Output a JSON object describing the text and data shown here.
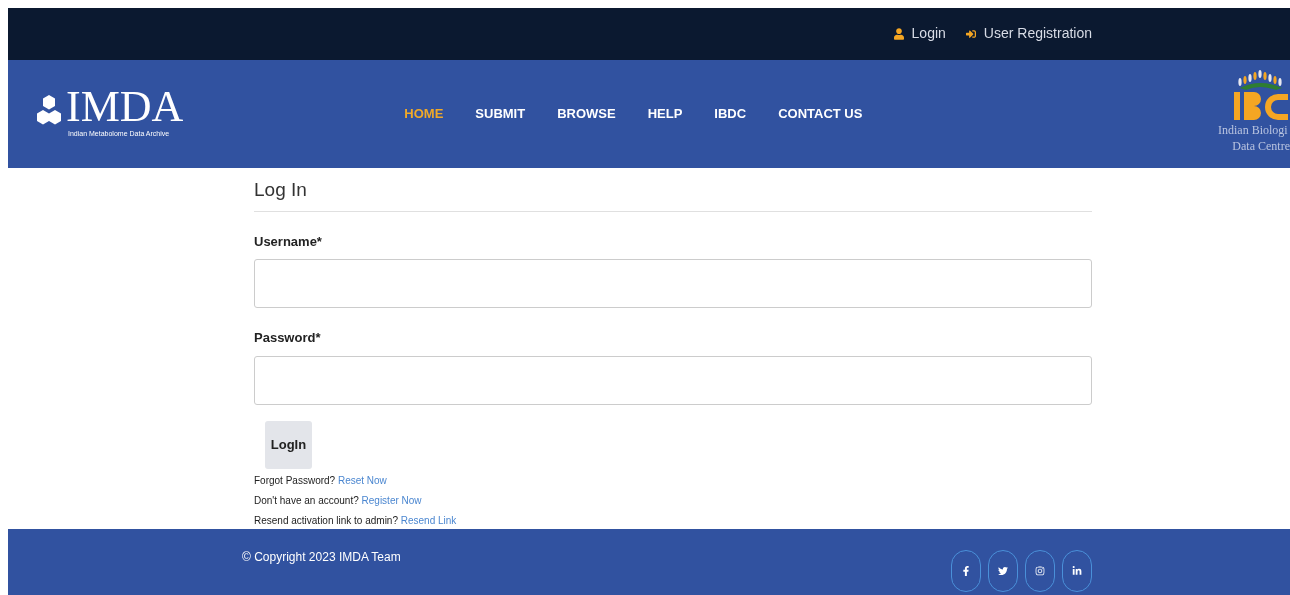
{
  "top_bar": {
    "links": [
      {
        "kind": "user",
        "label": "Login"
      },
      {
        "kind": "signin",
        "label": "User Registration"
      }
    ]
  },
  "header": {
    "logo": {
      "title": "IMDA",
      "subtitle": "Indian Metabolome Data Archive"
    },
    "nav": [
      {
        "label": "HOME",
        "selected": true
      },
      {
        "label": "SUBMIT",
        "selected": false
      },
      {
        "label": "BROWSE",
        "selected": false
      },
      {
        "label": "HELP",
        "selected": false
      },
      {
        "label": "IBDC",
        "selected": false
      },
      {
        "label": "CONTACT US",
        "selected": false
      }
    ],
    "partner_logo": {
      "lines": [
        "Indian Biologi",
        "Data Centre"
      ]
    }
  },
  "form": {
    "title": "Log In",
    "fields": [
      {
        "label": "Username*"
      },
      {
        "label": "Password*"
      }
    ],
    "button": "LogIn",
    "links": [
      {
        "text": "Forgot Password?",
        "link": "Reset Now"
      },
      {
        "text": "Don't have an account?",
        "link": "Register Now"
      },
      {
        "text": "Resend activation link to admin?",
        "link": "Resend Link"
      }
    ]
  },
  "footer": {
    "copyright": "© Copyright 2023 IMDA Team",
    "social": [
      {
        "kind": "facebook"
      },
      {
        "kind": "twitter"
      },
      {
        "kind": "instagram"
      },
      {
        "kind": "linkedin"
      }
    ]
  }
}
